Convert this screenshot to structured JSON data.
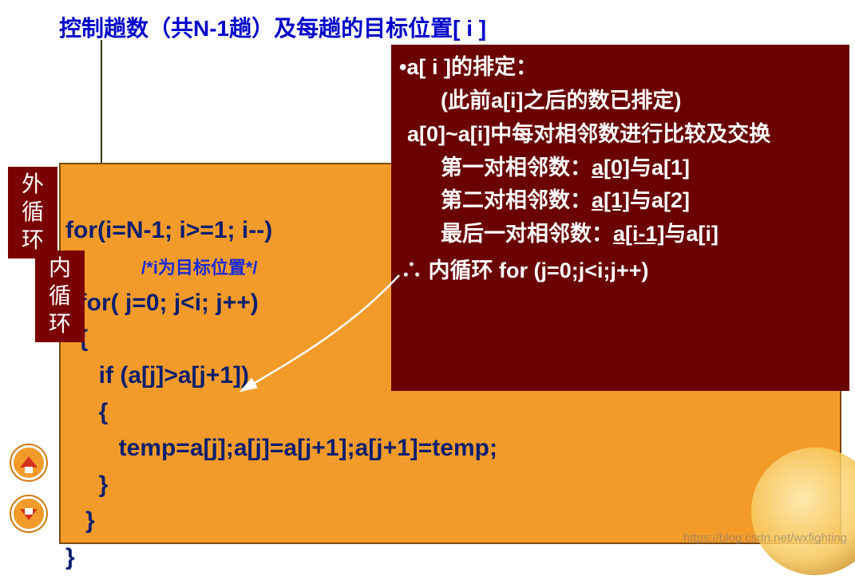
{
  "title": "控制趟数（共N-1趟）及每趟的目标位置[ i ]",
  "labels": {
    "outer": "外\n循环",
    "inner": "内\n循环"
  },
  "code": {
    "l1": "for(i=N-1; i>=1; i--)",
    "l2": "{",
    "comment": "/*i为目标位置*/",
    "l3": "  for( j=0; j<i; j++)",
    "l4": "  {",
    "l5": "     if (a[j]>a[j+1])",
    "l6": "     {",
    "l7": "        temp=a[j];a[j]=a[j+1];a[j+1]=temp;",
    "l8": "     }",
    "l9": "   }",
    "l10": "}"
  },
  "info": {
    "line1_a": "•a[ i ]的排定：",
    "line2": "(此前a[i]之后的数已排定)",
    "line3": "a[0]~a[i]中每对相邻数进行比较及交换",
    "pair1_pre": "第一对相邻数：",
    "pair1_u": "a[0]",
    "pair1_mid": "与a[1]",
    "pair2_pre": "第二对相邻数：",
    "pair2_u": "a[1]",
    "pair2_mid": "与a[2]",
    "pair3_pre": "最后一对相邻数：",
    "pair3_u": "a[i-1]",
    "pair3_mid": "与a[i]",
    "therefore": "∴ 内循环 for (j=0;j<i;j++)"
  },
  "nav": {
    "up": "previous-slide",
    "down": "next-slide"
  },
  "watermark": "https://blog.csdn.net/wxfighting"
}
